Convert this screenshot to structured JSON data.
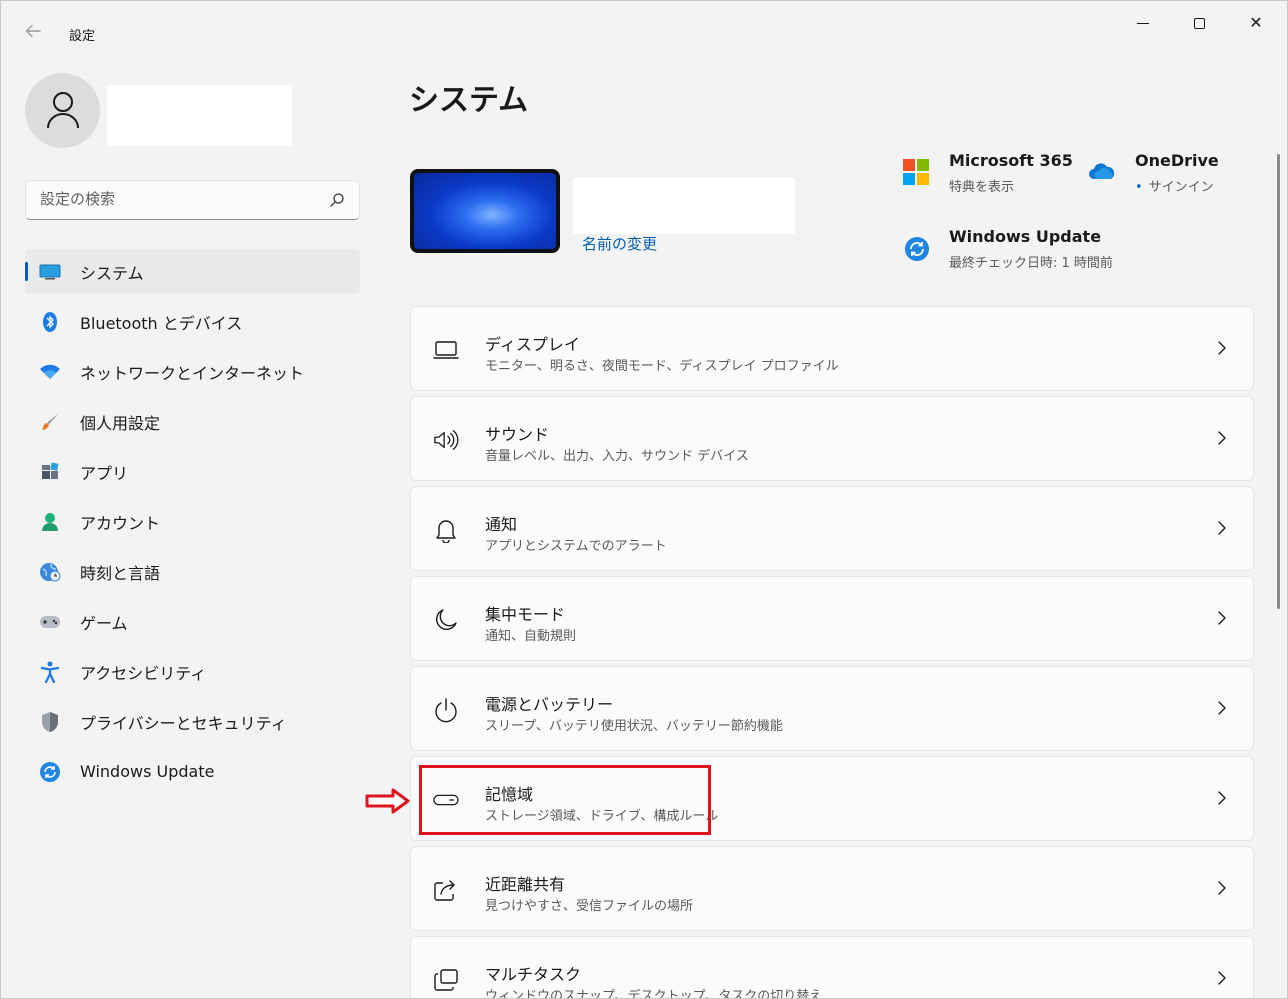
{
  "window": {
    "app_title": "設定",
    "back_icon": "back-arrow-icon",
    "minimize_icon": "minimize-icon",
    "maximize_icon": "maximize-icon",
    "close_glyph": "✕"
  },
  "sidebar": {
    "search": {
      "placeholder": "設定の検索"
    },
    "items": [
      {
        "label": "システム",
        "icon": "system-icon",
        "active": true
      },
      {
        "label": "Bluetooth とデバイス",
        "icon": "bluetooth-icon"
      },
      {
        "label": "ネットワークとインターネット",
        "icon": "wifi-icon"
      },
      {
        "label": "個人用設定",
        "icon": "brush-icon"
      },
      {
        "label": "アプリ",
        "icon": "apps-icon"
      },
      {
        "label": "アカウント",
        "icon": "account-icon"
      },
      {
        "label": "時刻と言語",
        "icon": "time-language-icon"
      },
      {
        "label": "ゲーム",
        "icon": "gamepad-icon"
      },
      {
        "label": "アクセシビリティ",
        "icon": "accessibility-icon"
      },
      {
        "label": "プライバシーとセキュリティ",
        "icon": "shield-icon"
      },
      {
        "label": "Windows Update",
        "icon": "windows-update-icon"
      }
    ]
  },
  "main": {
    "title": "システム",
    "rename_link": "名前の変更",
    "promos": {
      "ms365": {
        "title": "Microsoft 365",
        "sub": "特典を表示"
      },
      "onedrive": {
        "title": "OneDrive",
        "sub": "サインイン"
      },
      "update": {
        "title": "Windows Update",
        "sub": "最終チェック日時: 1 時間前"
      }
    },
    "cards": [
      {
        "title": "ディスプレイ",
        "sub": "モニター、明るさ、夜間モード、ディスプレイ プロファイル",
        "icon": "display-icon"
      },
      {
        "title": "サウンド",
        "sub": "音量レベル、出力、入力、サウンド デバイス",
        "icon": "speaker-icon"
      },
      {
        "title": "通知",
        "sub": "アプリとシステムでのアラート",
        "icon": "bell-icon"
      },
      {
        "title": "集中モード",
        "sub": "通知、自動規則",
        "icon": "moon-icon"
      },
      {
        "title": "電源とバッテリー",
        "sub": "スリープ、バッテリ使用状況、バッテリー節約機能",
        "icon": "power-icon"
      },
      {
        "title": "記憶域",
        "sub": "ストレージ領域、ドライブ、構成ルール",
        "icon": "storage-icon"
      },
      {
        "title": "近距離共有",
        "sub": "見つけやすさ、受信ファイルの場所",
        "icon": "share-icon"
      },
      {
        "title": "マルチタスク",
        "sub": "ウィンドウのスナップ、デスクトップ、タスクの切り替え",
        "icon": "multitask-icon"
      }
    ]
  },
  "colors": {
    "accent": "#005fb8",
    "highlight": "#e0141e"
  }
}
